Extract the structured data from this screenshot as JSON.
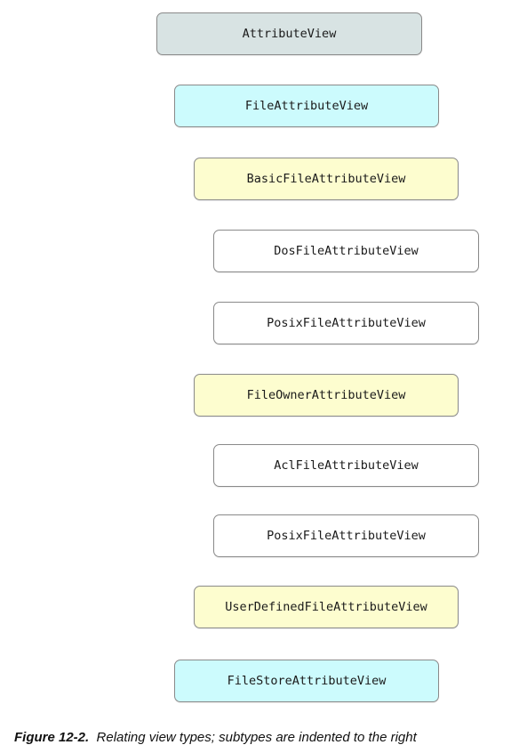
{
  "nodes": [
    {
      "label": "AttributeView",
      "color": "#d8e3e3"
    },
    {
      "label": "FileAttributeView",
      "color": "#ccfbfd"
    },
    {
      "label": "BasicFileAttributeView",
      "color": "#fdfdcf"
    },
    {
      "label": "DosFileAttributeView",
      "color": "#ffffff"
    },
    {
      "label": "PosixFileAttributeView",
      "color": "#ffffff"
    },
    {
      "label": "FileOwnerAttributeView",
      "color": "#fdfdcf"
    },
    {
      "label": "AclFileAttributeView",
      "color": "#ffffff"
    },
    {
      "label": "PosixFileAttributeView",
      "color": "#ffffff"
    },
    {
      "label": "UserDefinedFileAttributeView",
      "color": "#fdfdcf"
    },
    {
      "label": "FileStoreAttributeView",
      "color": "#ccfbfd"
    }
  ],
  "caption": {
    "figure_label": "Figure 12-2.",
    "text": "Relating view types; subtypes are indented to the right"
  }
}
